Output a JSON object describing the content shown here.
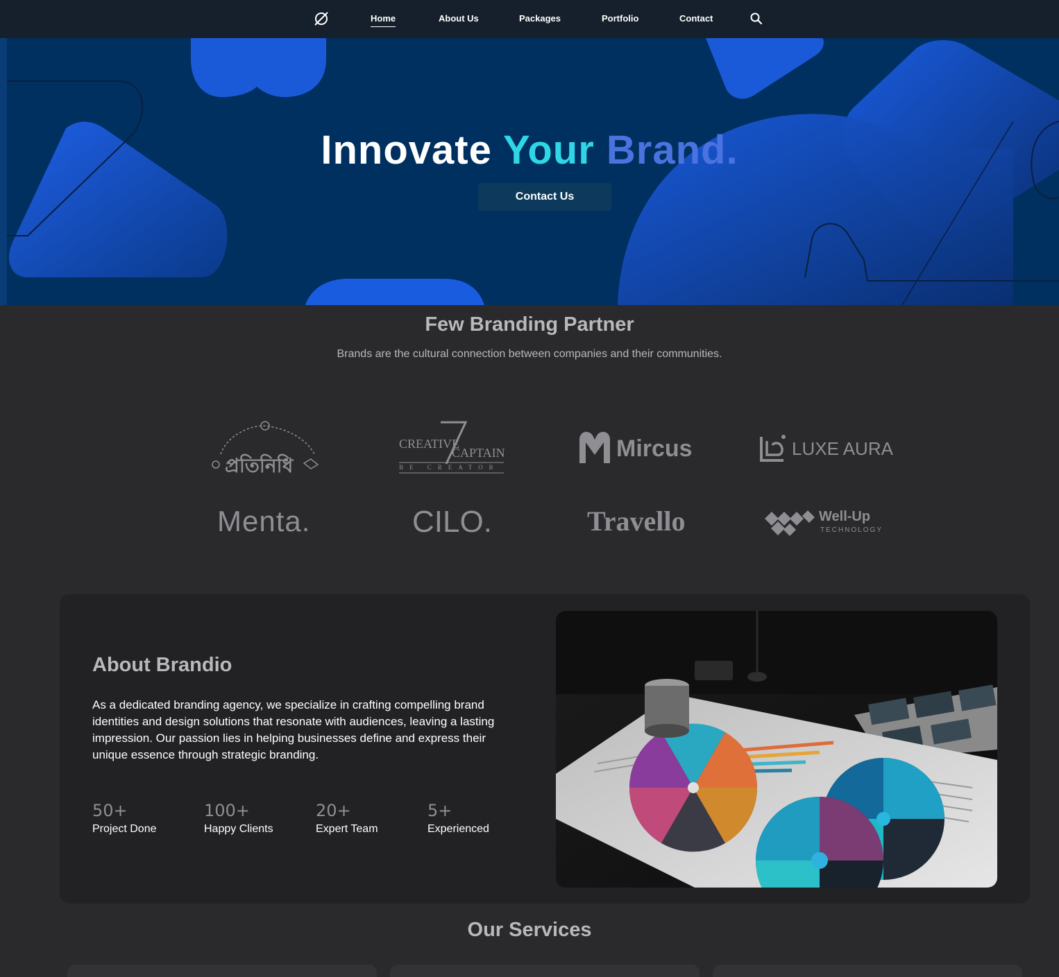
{
  "nav": {
    "logo_icon": "empty-set-logo-icon",
    "links": [
      "Home",
      "About Us",
      "Packages",
      "Portfolio",
      "Contact"
    ],
    "active": "Home",
    "search_icon": "search-icon"
  },
  "hero": {
    "title_word1": "Innovate",
    "title_word2": "Your",
    "title_word3": "Brand.",
    "button_label": "Contact Us"
  },
  "partners": {
    "title": "Few Branding Partner",
    "subtitle": "Brands are the cultural connection between companies and their communities.",
    "logos": [
      {
        "text": "প্রতিনিধি"
      },
      {
        "line1": "CREATIVE",
        "line2": "CAPTAIN",
        "tag": "BE CREATOR"
      },
      {
        "text": "Mircus"
      },
      {
        "text": "LUXE AURA"
      },
      {
        "text": "Menta."
      },
      {
        "text": "CILO."
      },
      {
        "text": "Travello"
      },
      {
        "text": "Well-Up",
        "tag": "TECHNOLOGY"
      }
    ]
  },
  "about": {
    "title": "About Brandio",
    "text": "As a dedicated branding agency, we specialize in crafting compelling brand identities and design solutions that resonate with audiences, leaving a lasting impression. Our passion lies in helping businesses define and express their unique essence through strategic branding.",
    "stats": [
      {
        "num": "50+",
        "label": "Project Done"
      },
      {
        "num": "100+",
        "label": "Happy Clients"
      },
      {
        "num": "20+",
        "label": "Expert Team"
      },
      {
        "num": "5+",
        "label": "Experienced"
      }
    ]
  },
  "services": {
    "title": "Our Services"
  },
  "colors": {
    "nav_bg": "#15202c",
    "hero_bg": "#00305f",
    "accent_blue": "#1a5ce0",
    "page_bg": "#2a2a2d",
    "card_bg": "#222224"
  }
}
